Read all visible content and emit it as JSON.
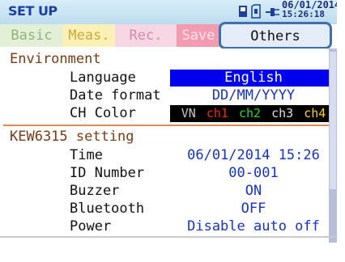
{
  "header": {
    "title": "SET UP",
    "date": "06/01/2014",
    "time": "15:26:18",
    "icons": [
      "card-icon",
      "memory-icon",
      "plug-icon"
    ]
  },
  "tabs": [
    {
      "label": "Basic",
      "state": "inactive"
    },
    {
      "label": "Meas.",
      "state": "inactive"
    },
    {
      "label": "Rec.",
      "state": "inactive"
    },
    {
      "label": "Save",
      "state": "inactive"
    },
    {
      "label": "Others",
      "state": "selected"
    }
  ],
  "environment": {
    "heading": "Environment",
    "rows": [
      {
        "label": "Language",
        "value": "English"
      },
      {
        "label": "Date format",
        "value": "DD/MM/YYYY"
      },
      {
        "label": "CH Color"
      }
    ],
    "ch_colors": [
      {
        "label": "VN",
        "color": "#c8c8c8"
      },
      {
        "label": "ch1",
        "color": "#ff2020"
      },
      {
        "label": "ch2",
        "color": "#22dd22"
      },
      {
        "label": "ch3",
        "color": "#dddddd"
      },
      {
        "label": "ch4",
        "color": "#ffd21a"
      }
    ]
  },
  "kew_setting": {
    "heading": "KEW6315 setting",
    "rows": [
      {
        "label": "Time",
        "value": "06/01/2014 15:26"
      },
      {
        "label": "ID Number",
        "value": "00-001"
      },
      {
        "label": "Buzzer",
        "value": "ON"
      },
      {
        "label": "Bluetooth",
        "value": "OFF"
      },
      {
        "label": "Power",
        "value": "Disable auto off"
      }
    ]
  },
  "colors": {
    "header_bg": "#c6e3f4",
    "selection": "#0000ee",
    "value_text": "#1732c8",
    "section_heading": "#7a3a12",
    "section_line": "#e08a4f"
  }
}
